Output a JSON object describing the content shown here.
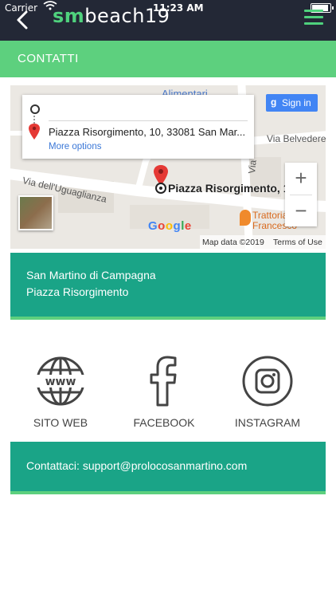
{
  "status_bar": {
    "carrier": "Carrier",
    "time": "11:23 AM"
  },
  "header": {
    "logo_bold": "sm",
    "logo_rest": "beach19"
  },
  "section": {
    "title": "CONTATTI"
  },
  "map": {
    "directions": {
      "destination": "Piazza Risorgimento, 10, 33081 San Mar...",
      "more_options": "More options"
    },
    "sign_in": "Sign in",
    "labels": {
      "alimentari": "Alimentari",
      "via_belvedere": "Via Belvedere",
      "via_uguaglianza": "Via dell'Uguaglianza",
      "via_partial": "Via",
      "place": "Piazza Risorgimento, 1",
      "trattoria": "Trattoria\nFrancesco"
    },
    "zoom_in": "+",
    "zoom_out": "−",
    "attribution": {
      "data": "Map data ©2019",
      "terms": "Terms of Use"
    },
    "google_logo": "Google"
  },
  "address": {
    "line1": "San Martino di Campagna",
    "line2": "Piazza Risorgimento"
  },
  "social": [
    {
      "label": "SITO WEB",
      "icon": "globe-www-icon"
    },
    {
      "label": "FACEBOOK",
      "icon": "facebook-icon"
    },
    {
      "label": "INSTAGRAM",
      "icon": "instagram-icon"
    }
  ],
  "contact": {
    "text": "Contattaci: support@prolocosanmartino.com"
  },
  "colors": {
    "header_bg": "#232836",
    "accent_green": "#5dd07e",
    "teal": "#1aa487",
    "logo_green": "#4fd17d"
  }
}
